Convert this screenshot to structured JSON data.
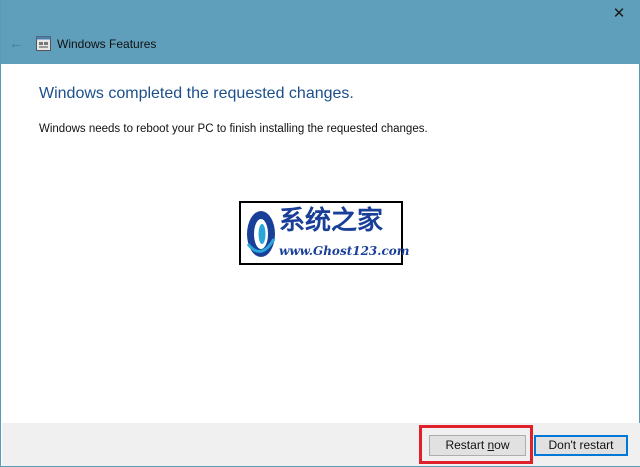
{
  "window": {
    "title": "Windows Features",
    "close_glyph": "✕",
    "back_glyph": "←"
  },
  "content": {
    "heading": "Windows completed the requested changes.",
    "message": "Windows needs to reboot your PC to finish installing the requested changes."
  },
  "watermark": {
    "title": "系统之家",
    "url": "www.Ghost123.com"
  },
  "buttons": {
    "restart_prefix": "Restart ",
    "restart_access_key": "n",
    "restart_suffix": "ow",
    "dont_restart": "Don't restart"
  },
  "colors": {
    "titlebar": "#5f9fbb",
    "heading_text": "#1c4f8a",
    "highlight": "#e0202a",
    "focus_border": "#0078d7"
  }
}
